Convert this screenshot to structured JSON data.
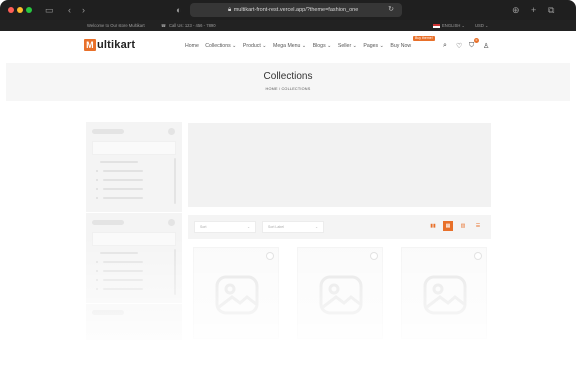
{
  "browser": {
    "url": "multikart-front-rest.vercel.app/?theme=fashion_one",
    "icons": [
      "sidebar-icon",
      "back-icon",
      "forward-icon",
      "shield-icon",
      "lock-icon",
      "reload-icon",
      "download-icon",
      "new-tab-icon",
      "tabs-icon"
    ]
  },
  "topbar": {
    "welcome": "Welcome to Our store Multikart",
    "phone": "Call Us: 123 - 456 - 7890",
    "language": "ENGLISH ⌄",
    "currency": "USD ⌄"
  },
  "header": {
    "logo_mark": "M",
    "logo_text": "ultikart",
    "nav": {
      "home": "Home",
      "collections": "Collections ⌄",
      "product": "Product ⌄",
      "mega_menu": "Mega Menu ⌄",
      "blogs": "Blogs ⌄",
      "seller": "Seller ⌄",
      "pages": "Pages ⌄",
      "buy_now": "Buy Now",
      "buy_badge": "Buy theme!"
    },
    "cart_count": "0",
    "accent": "#e8702a"
  },
  "breadcrumb": {
    "title": "Collections",
    "path": "HOME / COLLECTIONS"
  },
  "toolbar": {
    "sort_placeholder": "Sort",
    "sort_label_placeholder": "Sort Label"
  }
}
